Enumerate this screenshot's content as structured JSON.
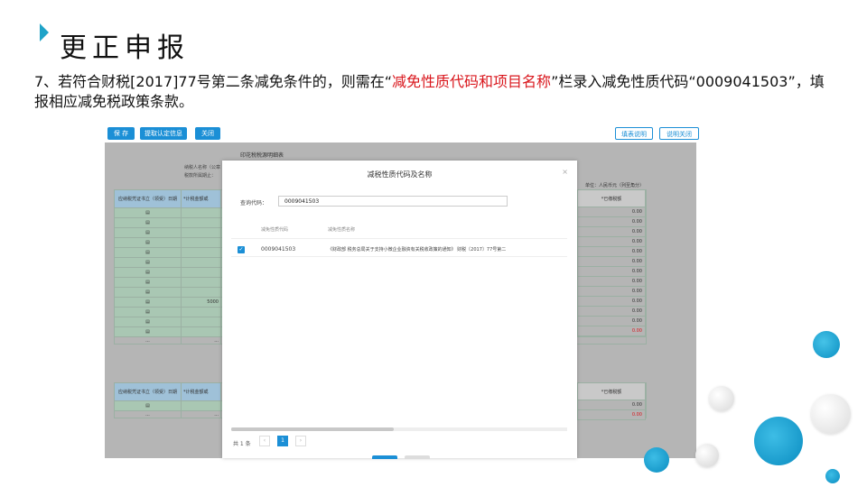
{
  "slide": {
    "title": "更正申报",
    "instruction_prefix": "7、若符合财税[2017]77号第二条减免条件的，则需在“",
    "instruction_highlight": "减免性质代码和项目名称",
    "instruction_suffix": "”栏录入减免性质代码“0009041503”，填报相应减免税政策条款。"
  },
  "toolbar": {
    "save_label": "保 存",
    "fetch_label": "提取认定信息",
    "close_label": "关闭",
    "fill_help_label": "填表说明",
    "close_help_label": "说明关闭"
  },
  "form": {
    "title": "印花税税源明细表",
    "taxpayer_label": "纳税人名称（公章",
    "period_label": "税款所属期止：",
    "unit_label": "单位：人民币元（列至角分）",
    "col_voucher": "应纳税凭证书立（领受）日期",
    "col_amount": "*计税金额或",
    "col_paid": "*已缴税额",
    "partial_value": "5000",
    "ellipsis": "...",
    "paid_values": [
      "0.00",
      "0.00",
      "0.00",
      "0.00",
      "0.00",
      "0.00",
      "0.00",
      "0.00",
      "0.00",
      "0.00",
      "0.00",
      "0.00"
    ],
    "total_value": "0.00",
    "second_col_voucher": "应纳税凭证书立（领受）日期",
    "second_col_amount": "*计税金额或",
    "second_col_paid": "*已缴税额",
    "second_paid_value": "0.00",
    "second_total_value": "0.00"
  },
  "modal": {
    "title": "减税性质代码及名称",
    "close_symbol": "×",
    "query_label": "查询代码：",
    "query_value": "0009041503",
    "col_code": "减免性质代码",
    "col_name": "减免性质名称",
    "row": {
      "checked": true,
      "code": "0009041503",
      "name": "《财政部 税务总局关于支持小微企业融资有关税收政策的通知》 财税〔2017〕77号第二"
    },
    "pager_total": "共 1 条",
    "pager_prev": "‹",
    "pager_current": "1",
    "pager_next": "›"
  },
  "colors": {
    "accent": "#1b8fd6",
    "title_marker": "#1fa3c8",
    "highlight_red": "#d9161c"
  }
}
